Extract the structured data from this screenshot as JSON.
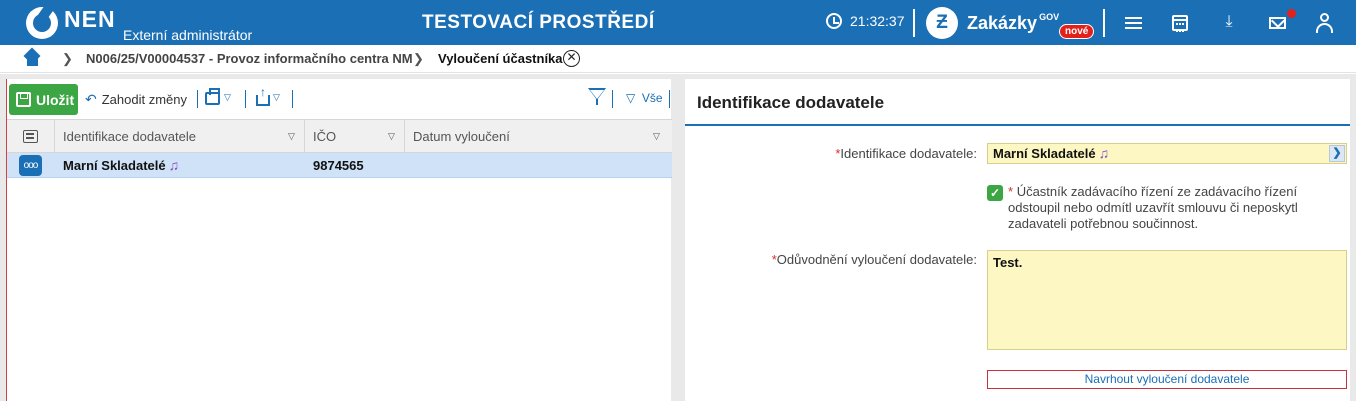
{
  "header": {
    "logo": "NEN",
    "role": "Externí administrátor",
    "environment": "TESTOVACÍ PROSTŘEDÍ",
    "time": "21:32:37",
    "zakazky": "Zakázky",
    "gov": "GOV",
    "new_badge": "nové",
    "icons": [
      "clock-icon",
      "menu-icon",
      "calendar-icon",
      "download-icon",
      "mail-icon",
      "user-icon"
    ]
  },
  "breadcrumb": {
    "items": [
      "N006/25/V00004537 - Provoz informačního centra NM"
    ],
    "current": "Vyloučení účastníka",
    "close": "✕"
  },
  "toolbar": {
    "save_label": "Uložit",
    "discard_label": "Zahodit změny",
    "filter_all": "Vše"
  },
  "grid": {
    "columns": [
      "Identifikace dodavatele",
      "IČO",
      "Datum vyloučení"
    ],
    "rows": [
      {
        "supplier": "Marní Skladatelé",
        "ico": "9874565",
        "date": ""
      }
    ]
  },
  "form": {
    "title": "Identifikace dodavatele",
    "supplier_label": "Identifikace dodavatele",
    "supplier_value": "Marní Skladatelé",
    "checkbox_checked": true,
    "checkbox_label": "Účastník zadávacího řízení ze zadávacího řízení odstoupil nebo odmítl uzavřít smlouvu či neposkytl zadavateli potřebnou součinnost.",
    "reason_label": "Odůvodnění vyloučení dodavatele",
    "reason_value": "Test.",
    "propose_button": "Navrhout vyloučení dodavatele"
  },
  "colors": {
    "primary": "#1a6fb5",
    "save": "#3da644",
    "field_bg": "#fdf7c3",
    "row_selected": "#cfe2f7",
    "alert": "#e2211c"
  }
}
